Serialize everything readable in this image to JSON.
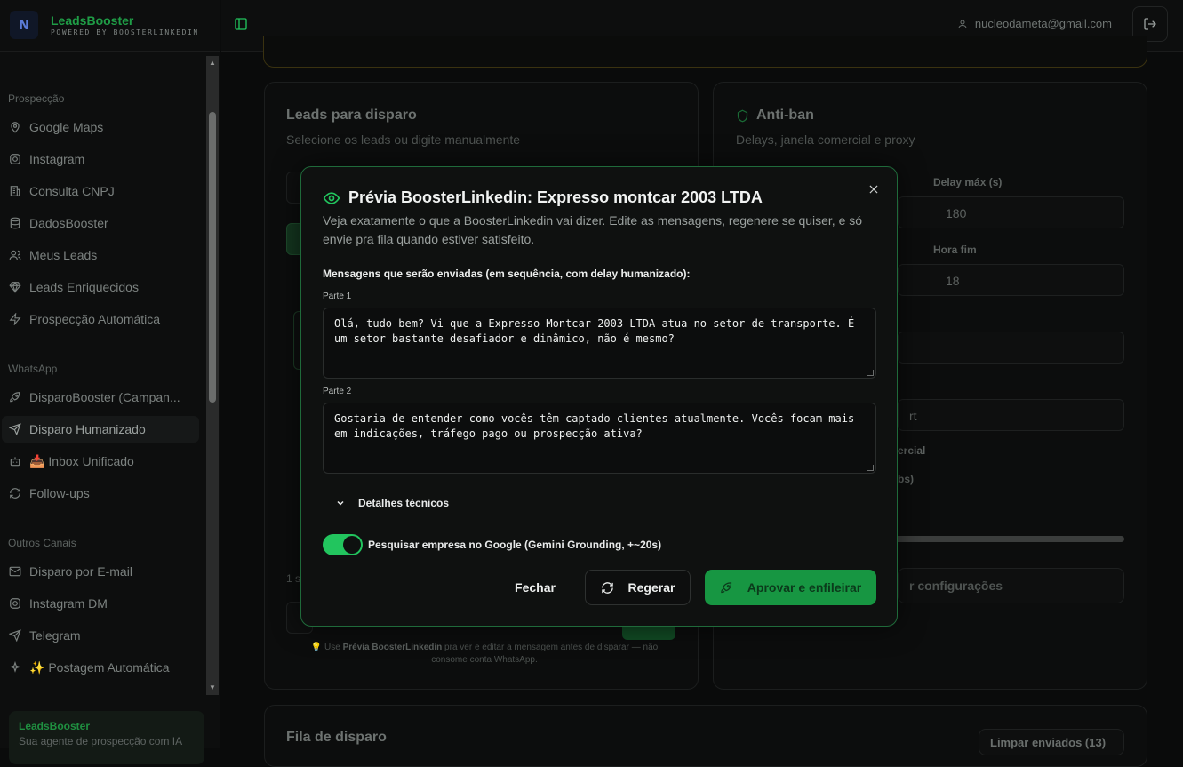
{
  "brand": {
    "logo_text": "N",
    "title": "LeadsBooster",
    "subtitle": "POWERED BY BOOSTERLINKEDIN"
  },
  "sidebar": {
    "sections": [
      {
        "label": "Prospecção"
      },
      {
        "label": "WhatsApp"
      },
      {
        "label": "Outros Canais"
      }
    ],
    "items": [
      {
        "label": "Google Maps",
        "icon": "map-pin-icon"
      },
      {
        "label": "Instagram",
        "icon": "instagram-icon"
      },
      {
        "label": "Consulta CNPJ",
        "icon": "building-icon"
      },
      {
        "label": "DadosBooster",
        "icon": "database-icon"
      },
      {
        "label": "Meus Leads",
        "icon": "users-icon"
      },
      {
        "label": "Leads Enriquecidos",
        "icon": "gem-icon"
      },
      {
        "label": "Prospecção Automática",
        "icon": "zap-icon"
      },
      {
        "label": "DisparoBooster (Campan...",
        "icon": "rocket-icon"
      },
      {
        "label": "Disparo Humanizado",
        "icon": "send-icon",
        "active": true
      },
      {
        "label": "📥 Inbox Unificado",
        "icon": "bot-icon"
      },
      {
        "label": "Follow-ups",
        "icon": "refresh-icon"
      },
      {
        "label": "Disparo por E-mail",
        "icon": "mail-icon"
      },
      {
        "label": "Instagram DM",
        "icon": "instagram-icon"
      },
      {
        "label": "Telegram",
        "icon": "send-icon"
      },
      {
        "label": "✨ Postagem Automática",
        "icon": "sparkles-icon"
      }
    ],
    "promo": {
      "title": "LeadsBooster",
      "subtitle": "Sua agente de prospecção com IA"
    }
  },
  "topbar": {
    "user_email": "nucleodameta@gmail.com"
  },
  "background": {
    "leads_card": {
      "title": "Leads para disparo",
      "subtitle": "Selecione os leads ou digite manualmente",
      "footer_fragment": "1 s"
    },
    "antiban_card": {
      "title": "Anti-ban",
      "subtitle": "Delays, janela comercial e proxy",
      "delay_max_label": "Delay máx (s)",
      "delay_max_value": "180",
      "hora_fim_label": "Hora fim",
      "hora_fim_value": "18",
      "fragment_rt": "rt",
      "fragment_ercial": "ercial",
      "fragment_bs": "bs)",
      "save_button_fragment": "r configurações"
    },
    "hint": {
      "prefix": "💡 Use ",
      "bold": "Prévia BoosterLinkedin",
      "suffix": " pra ver e editar a mensagem antes de disparar — não consome conta WhatsApp."
    },
    "queue_card": {
      "title": "Fila de disparo",
      "clear_button": "Limpar enviados (13)"
    }
  },
  "modal": {
    "title": "Prévia BoosterLinkedin: Expresso montcar 2003 LTDA",
    "description": "Veja exatamente o que a BoosterLinkedin vai dizer. Edite as mensagens, regenere se quiser, e só envie pra fila quando estiver satisfeito.",
    "messages_heading": "Mensagens que serão enviadas (em sequência, com delay humanizado):",
    "parts": [
      {
        "label": "Parte 1",
        "text": "Olá, tudo bem? Vi que a Expresso Montcar 2003 LTDA atua no setor de transporte. É um setor bastante desafiador e dinâmico, não é mesmo?"
      },
      {
        "label": "Parte 2",
        "text": "Gostaria de entender como vocês têm captado clientes atualmente. Vocês focam mais em indicações, tráfego pago ou prospecção ativa?"
      }
    ],
    "details_label": "Detalhes técnicos",
    "google_toggle": {
      "label": "Pesquisar empresa no Google (Gemini Grounding, +~20s)",
      "enabled": true
    },
    "buttons": {
      "close": "Fechar",
      "regenerate": "Regerar",
      "approve": "Aprovar e enfileirar"
    },
    "colors": {
      "accent": "#22c55e",
      "border": "#1f6a3a",
      "approve_bg": "#179642"
    }
  }
}
